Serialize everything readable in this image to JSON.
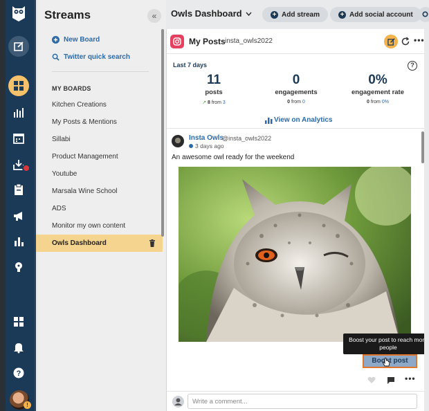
{
  "rail": {
    "icons": [
      "owl-logo",
      "compose-icon",
      "streams-icon",
      "analytics-icon",
      "planner-icon",
      "inbox-icon",
      "assignments-icon",
      "ads-icon",
      "reports-icon",
      "insights-icon",
      "apps-icon",
      "notifications-icon",
      "help-icon",
      "profile-avatar"
    ],
    "avatar_badge": "!"
  },
  "sidebar": {
    "title": "Streams",
    "collapse_label": "«",
    "new_board": "New Board",
    "twitter_search": "Twitter quick search",
    "boards_heading": "MY BOARDS",
    "boards": [
      "Kitchen Creations",
      "My Posts & Mentions",
      "Sillabi",
      "Product Management",
      "Youtube",
      "Marsala Wine School",
      "ADS",
      "Monitor my own content",
      "Owls Dashboard"
    ],
    "active_board_index": 8
  },
  "topbar": {
    "dashboard_title": "Owls Dashboard",
    "add_stream": "Add stream",
    "add_social_account": "Add social account"
  },
  "stream": {
    "title": "My Posts",
    "handle": "insta_owls2022",
    "period": "Last 7 days",
    "metrics": [
      {
        "value": "11",
        "label": "posts",
        "delta": "8",
        "from_text": "from",
        "from_value": "3"
      },
      {
        "value": "0",
        "label": "engagements",
        "delta": "0",
        "from_text": "from",
        "from_value": "0"
      },
      {
        "value": "0%",
        "label": "engagement rate",
        "delta": "0",
        "from_text": "from",
        "from_value": "0%"
      }
    ],
    "analytics_link": "View on Analytics"
  },
  "post": {
    "author": "Insta Owls",
    "handle": "@insta_owls2022",
    "time": "3 days ago",
    "text": "An awesome owl ready for the weekend",
    "tooltip": "Boost your post to reach more people",
    "boost_label": "Boost post",
    "comment_placeholder": "Write a comment..."
  },
  "colors": {
    "rail": "#1b3a57",
    "accent": "#f3b34a",
    "active_board": "#f5d48f",
    "link": "#2b6aa8",
    "instagram": "#e4405f",
    "boost_border": "#e0762b"
  }
}
